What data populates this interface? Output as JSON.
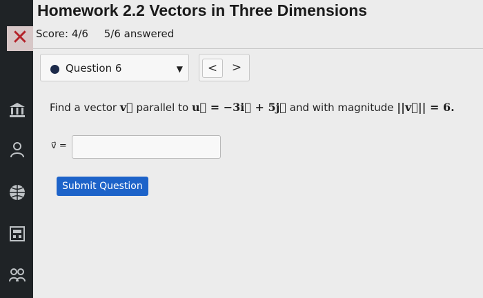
{
  "header": {
    "title": "Homework 2.2 Vectors in Three Dimensions",
    "score": "Score: 4/6",
    "answered": "5/6 answered"
  },
  "question_nav": {
    "selected": "Question 6",
    "prev_label": "<",
    "next_label": ">"
  },
  "question": {
    "prompt_start": "Find a vector",
    "vec_v": "v⃗",
    "middle": "parallel to",
    "expr": "u⃗ = −3i⃗ + 5j⃗",
    "and_magnitude": "and with magnitude",
    "magnitude_expr": "||v⃗|| = 6."
  },
  "answer": {
    "label": "v⃗ =",
    "value": ""
  },
  "submit_label": "Submit Question",
  "colors": {
    "accent": "#1d63c9",
    "close": "#b4232a",
    "rail": "#1f2326"
  }
}
